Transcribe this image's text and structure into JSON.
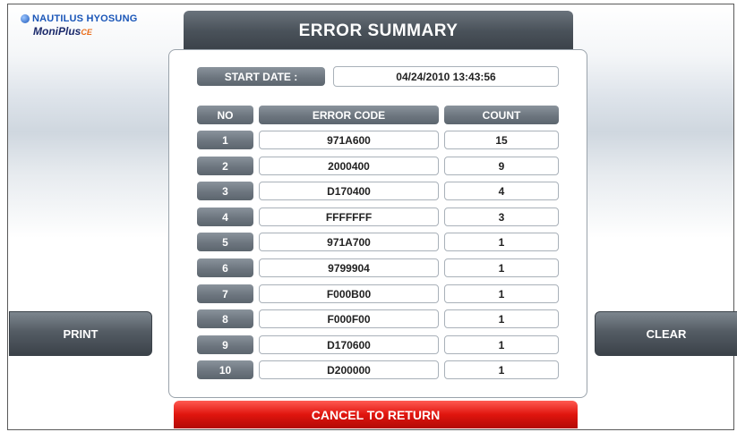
{
  "brand": {
    "company": "NAUTILUS HYOSUNG",
    "product": "MoniPlus",
    "product_suffix": "CE"
  },
  "screen": {
    "title": "ERROR SUMMARY"
  },
  "start_date": {
    "label": "START DATE :",
    "value": "04/24/2010 13:43:56"
  },
  "table": {
    "headers": {
      "no": "NO",
      "code": "ERROR CODE",
      "count": "COUNT"
    },
    "rows": [
      {
        "no": "1",
        "code": "971A600",
        "count": "15"
      },
      {
        "no": "2",
        "code": "2000400",
        "count": "9"
      },
      {
        "no": "3",
        "code": "D170400",
        "count": "4"
      },
      {
        "no": "4",
        "code": "FFFFFFF",
        "count": "3"
      },
      {
        "no": "5",
        "code": "971A700",
        "count": "1"
      },
      {
        "no": "6",
        "code": "9799904",
        "count": "1"
      },
      {
        "no": "7",
        "code": "F000B00",
        "count": "1"
      },
      {
        "no": "8",
        "code": "F000F00",
        "count": "1"
      },
      {
        "no": "9",
        "code": "D170600",
        "count": "1"
      },
      {
        "no": "10",
        "code": "D200000",
        "count": "1"
      }
    ]
  },
  "buttons": {
    "print": "PRINT",
    "clear": "CLEAR",
    "cancel": "CANCEL TO RETURN"
  },
  "colors": {
    "header_gray": "#4a525a",
    "chip_gray": "#6d767f",
    "cancel_red": "#e0150e",
    "brand_blue": "#1a56b8"
  }
}
